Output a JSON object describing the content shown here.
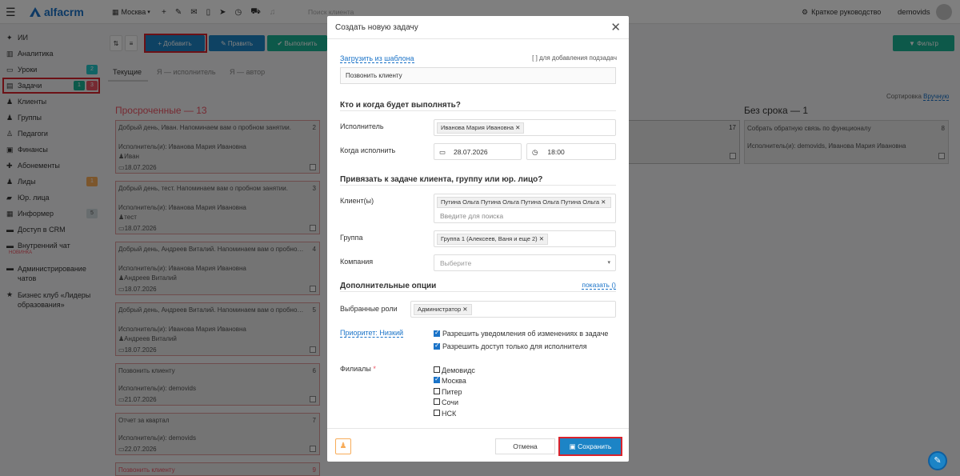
{
  "topbar": {
    "logo": "alfacrm",
    "city": "Москва",
    "search_placeholder": "Поиск клиента",
    "guide": "Краткое руководство",
    "user": "demovids"
  },
  "sidebar": {
    "items": [
      {
        "label": "ИИ",
        "icon": "ai-icon"
      },
      {
        "label": "Аналитика",
        "icon": "analytics-icon"
      },
      {
        "label": "Уроки",
        "icon": "calendar-icon",
        "badge": "2"
      },
      {
        "label": "Задачи",
        "icon": "tasks-icon",
        "badge1": "1",
        "badge2": "3"
      },
      {
        "label": "Клиенты",
        "icon": "user-icon"
      },
      {
        "label": "Группы",
        "icon": "users-icon"
      },
      {
        "label": "Педагоги",
        "icon": "teacher-icon"
      },
      {
        "label": "Финансы",
        "icon": "money-icon"
      },
      {
        "label": "Абонементы",
        "icon": "ticket-icon"
      },
      {
        "label": "Лиды",
        "icon": "lead-icon",
        "badge": "1"
      },
      {
        "label": "Юр. лица",
        "icon": "briefcase-icon"
      },
      {
        "label": "Информер",
        "icon": "informer-icon",
        "badge": "5"
      },
      {
        "label": "Доступ в CRM",
        "icon": "lock-icon"
      },
      {
        "label": "Внутренний чат",
        "icon": "chat-icon",
        "sub": "НОВИНКА"
      },
      {
        "label": "Администрирование чатов",
        "icon": "chat-admin-icon"
      },
      {
        "label": "Бизнес клуб «Лидеры образования»",
        "icon": "star-icon"
      }
    ]
  },
  "toolbar": {
    "add": "+ Добавить",
    "edit": "✎ Править",
    "done": "✔ Выполнить",
    "filter": "▼ Фильтр"
  },
  "tabs": [
    "Текущие",
    "Я — исполнитель",
    "Я — автор"
  ],
  "sorting": {
    "label": "Сортировка",
    "value": "Вручную"
  },
  "columns": {
    "overdue": "Просроченные — 13",
    "no_deadline": "Без срока — 1",
    "mid_count": "17"
  },
  "cards": [
    {
      "title": "Добрый день, Иван. Напоминаем вам о пробном занятии.",
      "num": "2",
      "exec": "Исполнитель(и): Иванова Мария Ивановна",
      "client": "Иван",
      "date": "18.07.2026"
    },
    {
      "title": "Добрый день, тест. Напоминаем вам о пробном занятии.",
      "num": "3",
      "exec": "Исполнитель(и): Иванова Мария Ивановна",
      "client": "тест",
      "date": "18.07.2026"
    },
    {
      "title": "Добрый день, Андреев Виталий. Напоминаем вам о пробном ...",
      "num": "4",
      "exec": "Исполнитель(и): Иванова Мария Ивановна",
      "client": "Андреев Виталий",
      "date": "18.07.2026"
    },
    {
      "title": "Добрый день, Андреев Виталий. Напоминаем вам о пробном ...",
      "num": "5",
      "exec": "Исполнитель(и): Иванова Мария Ивановна",
      "client": "Андреев Виталий",
      "date": "18.07.2026"
    },
    {
      "title": "Позвонить клиенту",
      "num": "6",
      "exec": "Исполнитель(и): demovids",
      "client": "",
      "date": "21.07.2026"
    },
    {
      "title": "Отчет за квартал",
      "num": "7",
      "exec": "Исполнитель(и): demovids",
      "client": "",
      "date": "22.07.2026"
    },
    {
      "title": "Позвонить клиенту",
      "num": "9",
      "exec": "",
      "client": "",
      "date": ""
    }
  ],
  "right_card": {
    "title": "Собрать обратную связь по функционалу",
    "num": "8",
    "exec": "Исполнитель(и): demovids, Иванова Мария Ивановна"
  },
  "modal": {
    "title": "Создать новую задачу",
    "template_link": "Загрузить из шаблона",
    "subtask_hint": "[ ] для добавления подзадач",
    "task_text": "Позвонить клиенту",
    "sec1": "Кто и когда будет выполнять?",
    "executor_label": "Исполнитель",
    "executor_value": "Иванова Мария Ивановна",
    "when_label": "Когда исполнить",
    "date": "28.07.2026",
    "time": "18:00",
    "sec2": "Привязать к задаче клиента, группу или юр. лицо?",
    "client_label": "Клиент(ы)",
    "client_value": "Путина Ольга Путина Ольга Путина Ольга Путина Ольга",
    "client_placeholder": "Введите для поиска",
    "group_label": "Группа",
    "group_value": "Группа 1 (Алексеев, Ваня и еще 2)",
    "company_label": "Компания",
    "company_placeholder": "Выберите",
    "sec3": "Дополнительные опции",
    "show_link": "показать ()",
    "roles_label": "Выбранные роли",
    "roles_value": "Администратор",
    "priority_link": "Приоритет: Низкий",
    "opt1": "Разрешить уведомления об изменениях в задаче",
    "opt2": "Разрешить доступ только для исполнителя",
    "branches_label": "Филиалы",
    "branches": [
      {
        "name": "Демовидс",
        "checked": false
      },
      {
        "name": "Москва",
        "checked": true
      },
      {
        "name": "Питер",
        "checked": false
      },
      {
        "name": "Сочи",
        "checked": false
      },
      {
        "name": "НСК",
        "checked": false
      }
    ],
    "cancel": "Отмена",
    "save": "Сохранить"
  }
}
